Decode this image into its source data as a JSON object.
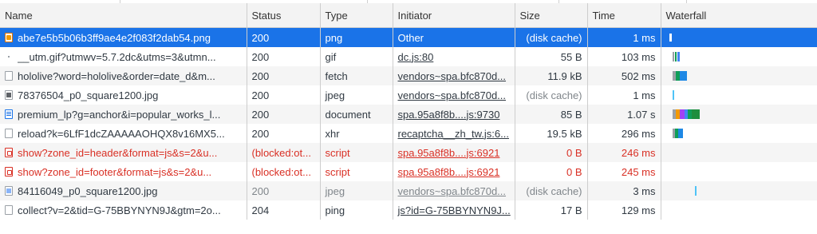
{
  "columns": {
    "name": "Name",
    "status": "Status",
    "type": "Type",
    "initiator": "Initiator",
    "size": "Size",
    "time": "Time",
    "waterfall": "Waterfall"
  },
  "rows": [
    {
      "icon": "png-file-icon",
      "name": "abe7e5b5b06b3ff9ae4e2f083f2dab54.png",
      "status": "200",
      "type": "png",
      "initiator": "Other",
      "size": "(disk cache)",
      "time": "1 ms",
      "selected": true
    },
    {
      "icon": "gif-file-icon",
      "name": "__utm.gif?utmwv=5.7.2dc&utms=3&utmn...",
      "status": "200",
      "type": "gif",
      "initiator": "dc.js:80",
      "size": "55 B",
      "time": "103 ms"
    },
    {
      "icon": "fetch-file-icon",
      "name": "hololive?word=hololive&order=date_d&m...",
      "status": "200",
      "type": "fetch",
      "initiator": "vendors~spa.bfc870d...",
      "size": "11.9 kB",
      "time": "502 ms"
    },
    {
      "icon": "image-file-icon",
      "name": "78376504_p0_square1200.jpg",
      "status": "200",
      "type": "jpeg",
      "initiator": "vendors~spa.bfc870d...",
      "size": "(disk cache)",
      "time": "1 ms"
    },
    {
      "icon": "document-file-icon",
      "name": "premium_lp?g=anchor&i=popular_works_l...",
      "status": "200",
      "type": "document",
      "initiator": "spa.95a8f8b....js:9730",
      "size": "85 B",
      "time": "1.07 s"
    },
    {
      "icon": "xhr-file-icon",
      "name": "reload?k=6LfF1dcZAAAAAOHQX8v16MX5...",
      "status": "200",
      "type": "xhr",
      "initiator": "recaptcha__zh_tw.js:6...",
      "size": "19.5 kB",
      "time": "296 ms"
    },
    {
      "icon": "blocked-script-icon",
      "name": "show?zone_id=header&format=js&s=2&u...",
      "status": "(blocked:ot...",
      "type": "script",
      "initiator": "spa.95a8f8b....js:6921",
      "size": "0 B",
      "time": "246 ms",
      "blocked": true
    },
    {
      "icon": "blocked-script-icon",
      "name": "show?zone_id=footer&format=js&s=2&u...",
      "status": "(blocked:ot...",
      "type": "script",
      "initiator": "spa.95a8f8b....js:6921",
      "size": "0 B",
      "time": "245 ms",
      "blocked": true
    },
    {
      "icon": "image-file-icon",
      "name": "84116049_p0_square1200.jpg",
      "status": "200",
      "type": "jpeg",
      "initiator": "vendors~spa.bfc870d...",
      "size": "(disk cache)",
      "time": "3 ms"
    },
    {
      "icon": "ping-file-icon",
      "name": "collect?v=2&tid=G-75BBYNYN9J&gtm=2o...",
      "status": "204",
      "type": "ping",
      "initiator": "js?id=G-75BBYNYN9J...",
      "size": "17 B",
      "time": "129 ms"
    }
  ],
  "colors": {
    "selected": "#1a73e8",
    "blocked": "#d93025",
    "header_bg": "#f3f3f3"
  }
}
